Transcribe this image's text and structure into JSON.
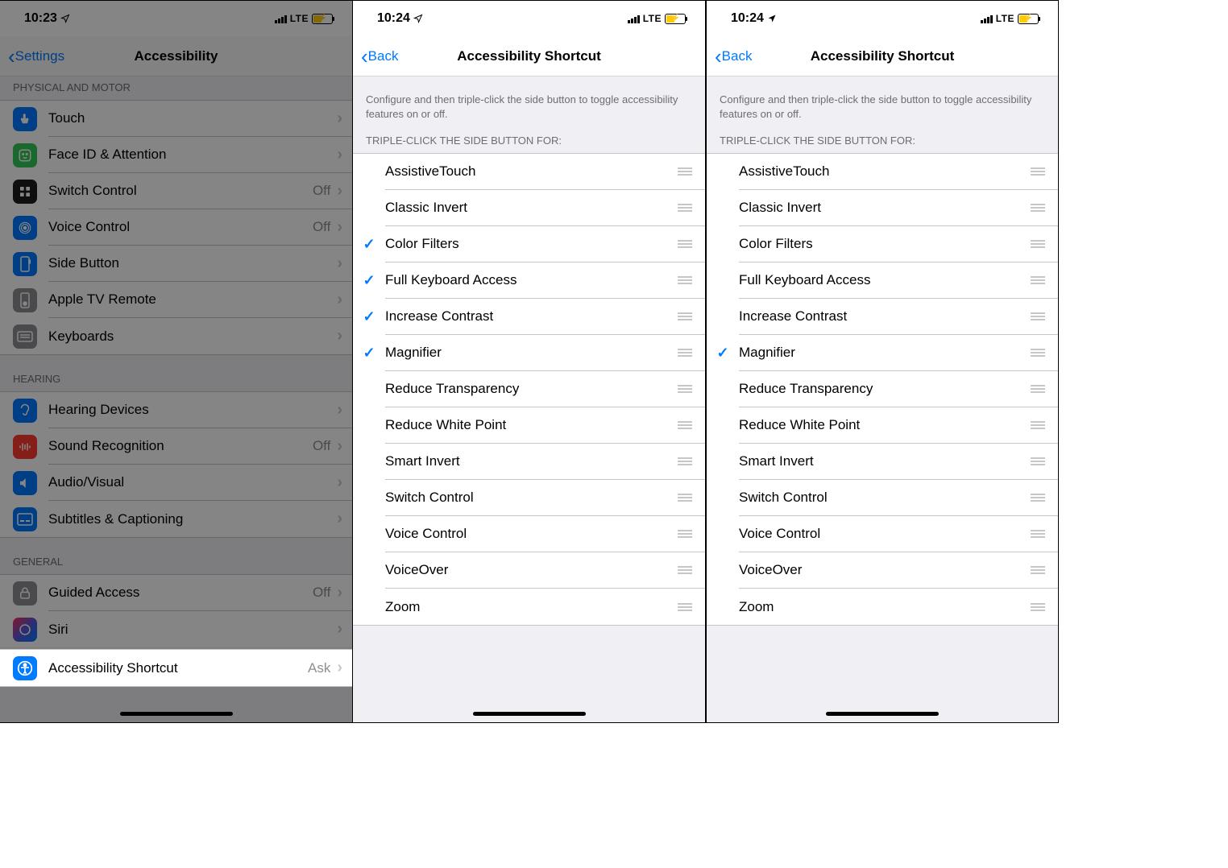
{
  "screen1": {
    "time": "10:23",
    "carrier": "LTE",
    "back_label": "Settings",
    "title": "Accessibility",
    "sections": {
      "physical": {
        "header": "PHYSICAL AND MOTOR"
      },
      "hearing": {
        "header": "HEARING"
      },
      "general": {
        "header": "GENERAL"
      }
    },
    "rows": {
      "touch": "Touch",
      "faceid": "Face ID & Attention",
      "switch": "Switch Control",
      "switch_detail": "Off",
      "voice": "Voice Control",
      "voice_detail": "Off",
      "sidebtn": "Side Button",
      "appletv": "Apple TV Remote",
      "keyboards": "Keyboards",
      "hearingdev": "Hearing Devices",
      "soundrec": "Sound Recognition",
      "soundrec_detail": "Off",
      "audiovisual": "Audio/Visual",
      "subtitles": "Subtitles & Captioning",
      "guided": "Guided Access",
      "guided_detail": "Off",
      "siri": "Siri",
      "shortcut": "Accessibility Shortcut",
      "shortcut_detail": "Ask"
    }
  },
  "screen2": {
    "time": "10:24",
    "carrier": "LTE",
    "back_label": "Back",
    "title": "Accessibility Shortcut",
    "desc": "Configure and then triple-click the side button to toggle accessibility features on or off.",
    "header": "TRIPLE-CLICK THE SIDE BUTTON FOR:",
    "items": [
      {
        "label": "AssistiveTouch",
        "checked": false
      },
      {
        "label": "Classic Invert",
        "checked": false
      },
      {
        "label": "Color Filters",
        "checked": true
      },
      {
        "label": "Full Keyboard Access",
        "checked": true
      },
      {
        "label": "Increase Contrast",
        "checked": true
      },
      {
        "label": "Magnifier",
        "checked": true
      },
      {
        "label": "Reduce Transparency",
        "checked": false
      },
      {
        "label": "Reduce White Point",
        "checked": false
      },
      {
        "label": "Smart Invert",
        "checked": false
      },
      {
        "label": "Switch Control",
        "checked": false
      },
      {
        "label": "Voice Control",
        "checked": false
      },
      {
        "label": "VoiceOver",
        "checked": false
      },
      {
        "label": "Zoom",
        "checked": false
      }
    ]
  },
  "screen3": {
    "time": "10:24",
    "carrier": "LTE",
    "back_label": "Back",
    "title": "Accessibility Shortcut",
    "desc": "Configure and then triple-click the side button to toggle accessibility features on or off.",
    "header": "TRIPLE-CLICK THE SIDE BUTTON FOR:",
    "items": [
      {
        "label": "AssistiveTouch",
        "checked": false
      },
      {
        "label": "Classic Invert",
        "checked": false
      },
      {
        "label": "Color Filters",
        "checked": false
      },
      {
        "label": "Full Keyboard Access",
        "checked": false
      },
      {
        "label": "Increase Contrast",
        "checked": false
      },
      {
        "label": "Magnifier",
        "checked": true
      },
      {
        "label": "Reduce Transparency",
        "checked": false
      },
      {
        "label": "Reduce White Point",
        "checked": false
      },
      {
        "label": "Smart Invert",
        "checked": false
      },
      {
        "label": "Switch Control",
        "checked": false
      },
      {
        "label": "Voice Control",
        "checked": false
      },
      {
        "label": "VoiceOver",
        "checked": false
      },
      {
        "label": "Zoom",
        "checked": false
      }
    ]
  }
}
